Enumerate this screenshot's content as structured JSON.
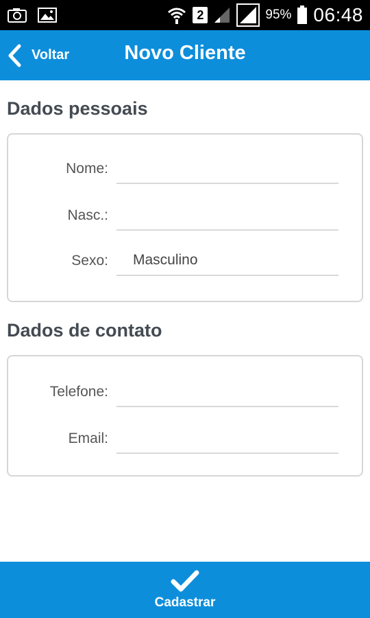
{
  "status_bar": {
    "icons_left": [
      "screenshot-icon",
      "gallery-icon"
    ],
    "sim_number": "2",
    "battery_percent": "95%",
    "time": "06:48"
  },
  "header": {
    "back_label": "Voltar",
    "title": "Novo Cliente"
  },
  "sections": {
    "personal": {
      "title": "Dados pessoais",
      "fields": {
        "name": {
          "label": "Nome:",
          "value": ""
        },
        "birth": {
          "label": "Nasc.:",
          "value": ""
        },
        "sex": {
          "label": "Sexo:",
          "value": "Masculino"
        }
      }
    },
    "contact": {
      "title": "Dados de contato",
      "fields": {
        "phone": {
          "label": "Telefone:",
          "value": ""
        },
        "email": {
          "label": "Email:",
          "value": ""
        }
      }
    }
  },
  "footer": {
    "submit_label": "Cadastrar"
  },
  "colors": {
    "primary": "#0d8edb",
    "status_bar": "#000000",
    "section_title": "#444b52",
    "card_border": "#d6d6d6"
  }
}
